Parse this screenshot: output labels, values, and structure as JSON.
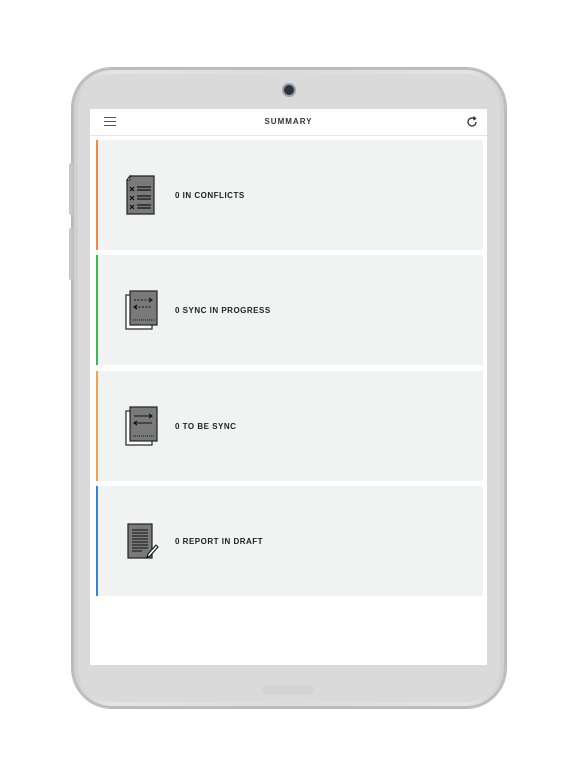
{
  "header": {
    "title": "SUMMARY"
  },
  "icons": {
    "menu": "menu-icon",
    "refresh": "refresh-icon"
  },
  "cards": [
    {
      "label": "0 IN CONFLICTS",
      "accent": "#f08a3c",
      "icon": "conflicts-document-icon"
    },
    {
      "label": "0 SYNC IN PROGRESS",
      "accent": "#2fbf4f",
      "icon": "sync-progress-icon"
    },
    {
      "label": "0 TO BE SYNC",
      "accent": "#f5a24a",
      "icon": "to-be-sync-icon"
    },
    {
      "label": "0 REPORT IN DRAFT",
      "accent": "#2f86d1",
      "icon": "report-draft-icon"
    }
  ],
  "colors": {
    "card_bg": "#f1f2f2",
    "bezel": "#dcdcdc",
    "icon_fill": "#7a7a7a"
  }
}
